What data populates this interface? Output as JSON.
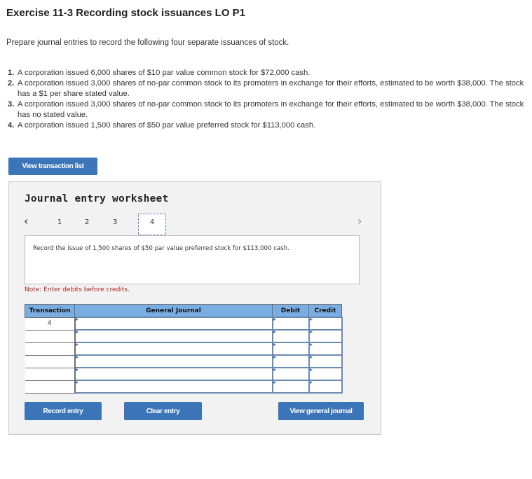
{
  "header": {
    "title": "Exercise 11-3 Recording stock issuances LO P1",
    "instructions": "Prepare journal entries to record the following four separate issuances of stock."
  },
  "transactions": [
    {
      "number": "1.",
      "text": "A corporation issued 6,000 shares of $10 par value common stock for $72,000 cash."
    },
    {
      "number": "2.",
      "text": "A corporation issued 3,000 shares of no-par common stock to its promoters in exchange for their efforts, estimated to be worth $38,000. The stock has a $1 per share stated value."
    },
    {
      "number": "3.",
      "text": "A corporation issued 3,000 shares of no-par common stock to its promoters in exchange for their efforts, estimated to be worth $38,000. The stock has no stated value."
    },
    {
      "number": "4.",
      "text": "A corporation issued 1,500 shares of $50 par value preferred stock for $113,000 cash."
    }
  ],
  "buttons": {
    "view_transaction_list": "View transaction list",
    "record_entry": "Record entry",
    "clear_entry": "Clear entry",
    "view_general_journal": "View general journal"
  },
  "worksheet": {
    "title": "Journal entry worksheet",
    "prev_icon": "‹",
    "next_icon": "›",
    "tabs": [
      "1",
      "2",
      "3",
      "4"
    ],
    "active_tab": "4",
    "prompt": "Record the issue of 1,500 shares of $50 par value preferred stock for $113,000 cash.",
    "note": "Note: Enter debits before credits.",
    "table": {
      "columns": [
        "Transaction",
        "General Journal",
        "Debit",
        "Credit"
      ],
      "rows": [
        {
          "transaction": "4",
          "account": "",
          "debit": "",
          "credit": ""
        },
        {
          "transaction": "",
          "account": "",
          "debit": "",
          "credit": ""
        },
        {
          "transaction": "",
          "account": "",
          "debit": "",
          "credit": ""
        },
        {
          "transaction": "",
          "account": "",
          "debit": "",
          "credit": ""
        },
        {
          "transaction": "",
          "account": "",
          "debit": "",
          "credit": ""
        },
        {
          "transaction": "",
          "account": "",
          "debit": "",
          "credit": ""
        }
      ]
    }
  },
  "colors": {
    "button_blue": "#3c74b8",
    "table_header_blue": "#7aaee3",
    "note_red": "#b22222",
    "panel_gray": "#f2f2f2"
  }
}
